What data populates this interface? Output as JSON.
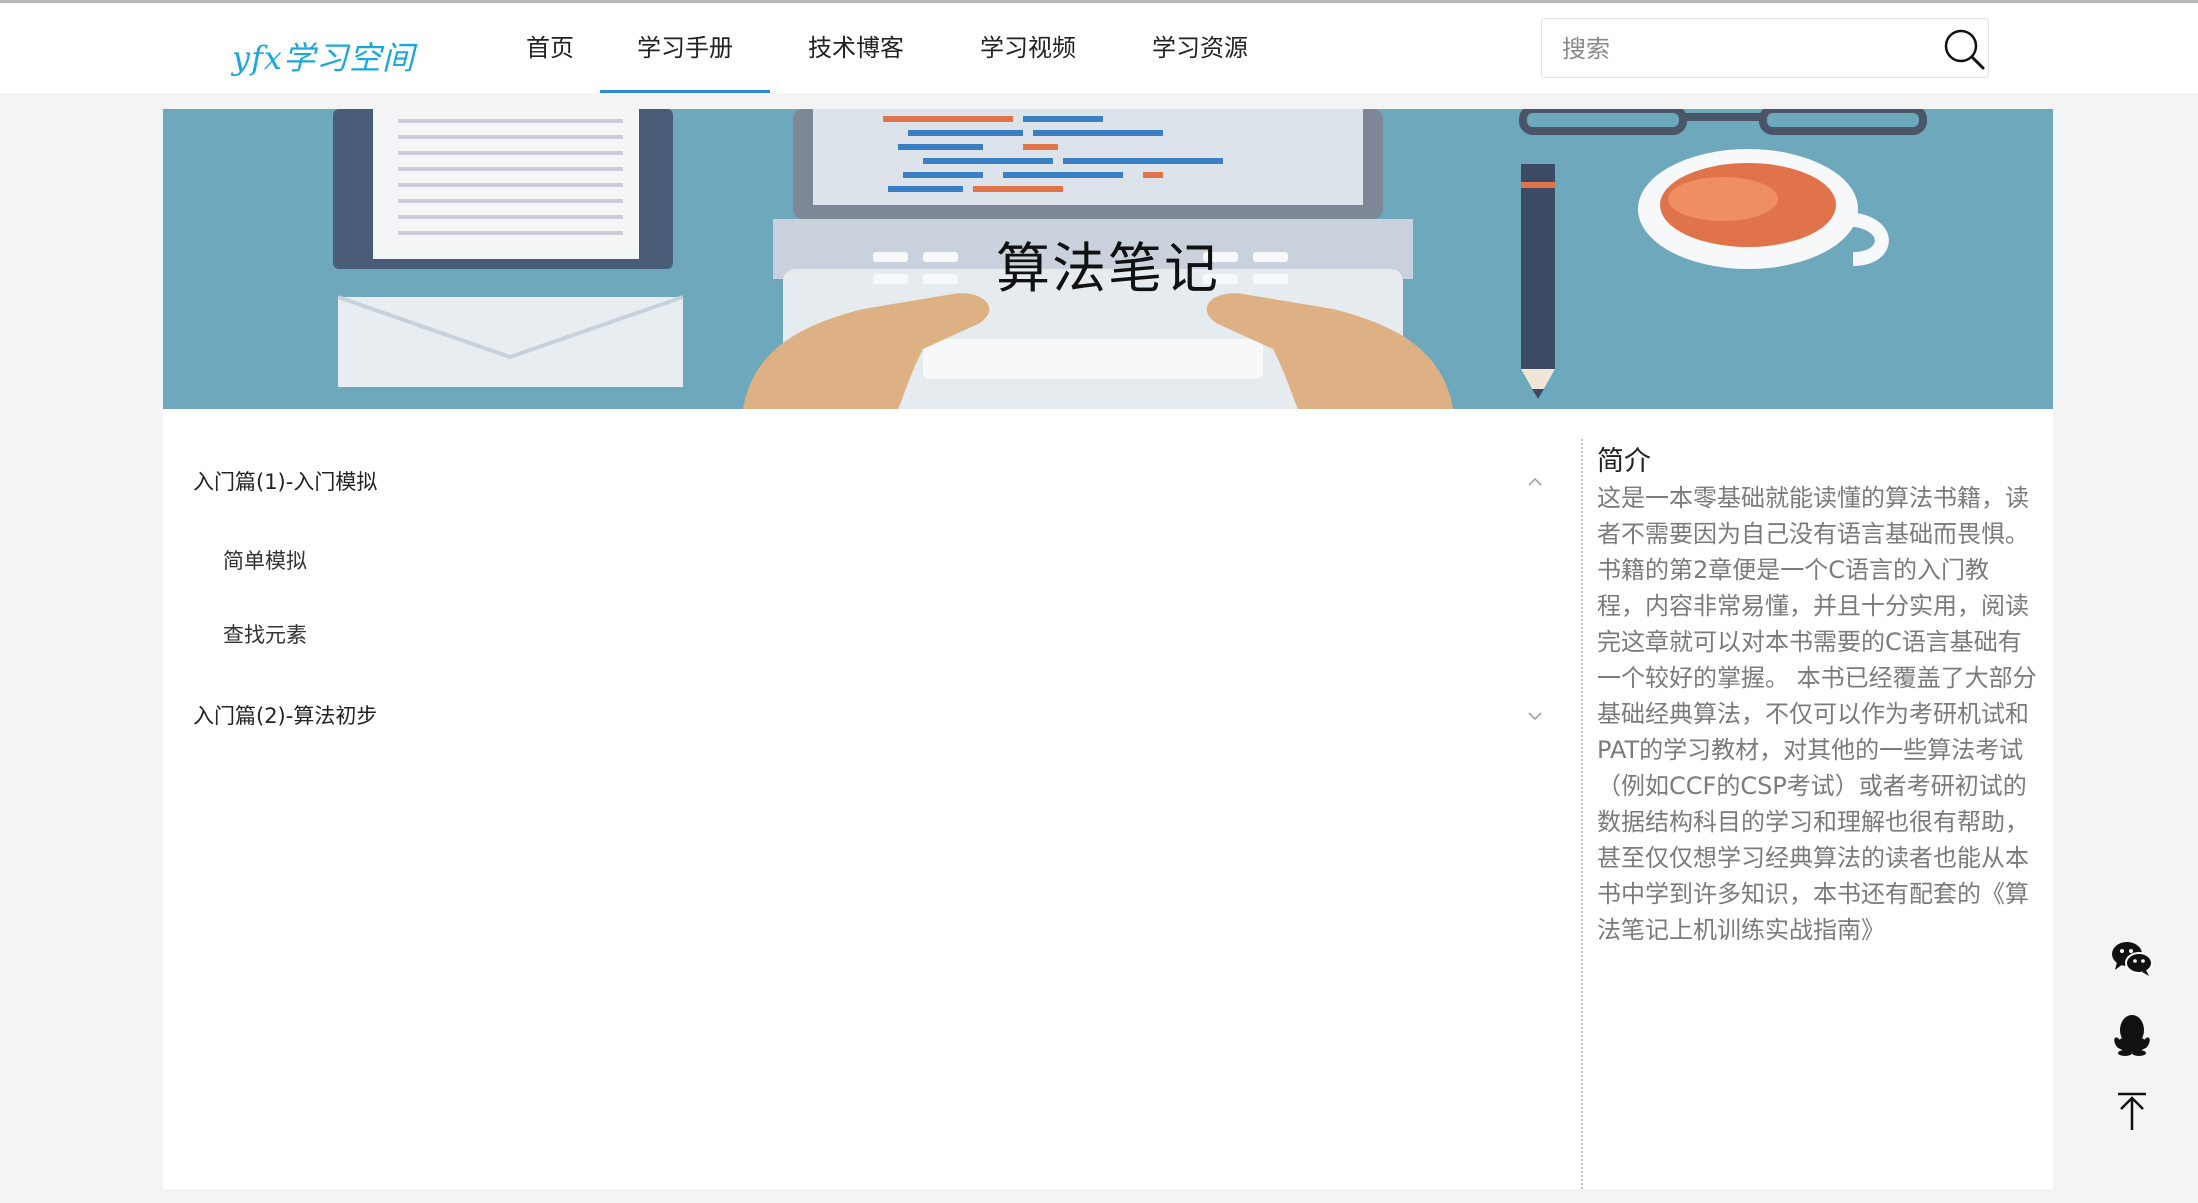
{
  "header": {
    "logo_text": "yfx学习空间",
    "nav": [
      {
        "label": "首页",
        "active": false
      },
      {
        "label": "学习手册",
        "active": true
      },
      {
        "label": "技术博客",
        "active": false
      },
      {
        "label": "学习视频",
        "active": false
      },
      {
        "label": "学习资源",
        "active": false
      }
    ],
    "search": {
      "placeholder": "搜索",
      "value": "",
      "icon": "search-icon"
    }
  },
  "banner": {
    "title": "算法笔记"
  },
  "catalog": {
    "chapters": [
      {
        "title": "入门篇(1)-入门模拟",
        "expanded": true,
        "icon": "chevron-up-icon",
        "sections": [
          "简单模拟",
          "查找元素"
        ]
      },
      {
        "title": "入门篇(2)-算法初步",
        "expanded": false,
        "icon": "chevron-down-icon",
        "sections": []
      }
    ]
  },
  "intro": {
    "title": "简介",
    "text": "这是一本零基础就能读懂的算法书籍，读者不需要因为自己没有语言基础而畏惧。书籍的第2章便是一个C语言的入门教程，内容非常易懂，并且十分实用，阅读完这章就可以对本书需要的C语言基础有一个较好的掌握。 本书已经覆盖了大部分基础经典算法，不仅可以作为考研机试和PAT的学习教材，对其他的一些算法考试（例如CCF的CSP考试）或者考研初试的数据结构科目的学习和理解也很有帮助，甚至仅仅想学习经典算法的读者也能从本书中学到许多知识，本书还有配套的《算法笔记上机训练实战指南》"
  },
  "side_buttons": [
    "wechat-icon",
    "qq-icon",
    "back-to-top-icon"
  ],
  "colors": {
    "accent": "#2d8ad6",
    "logo": "#1ba7dc",
    "banner_bg": "#6ea8bc",
    "intro_text": "#7b7b7b"
  }
}
